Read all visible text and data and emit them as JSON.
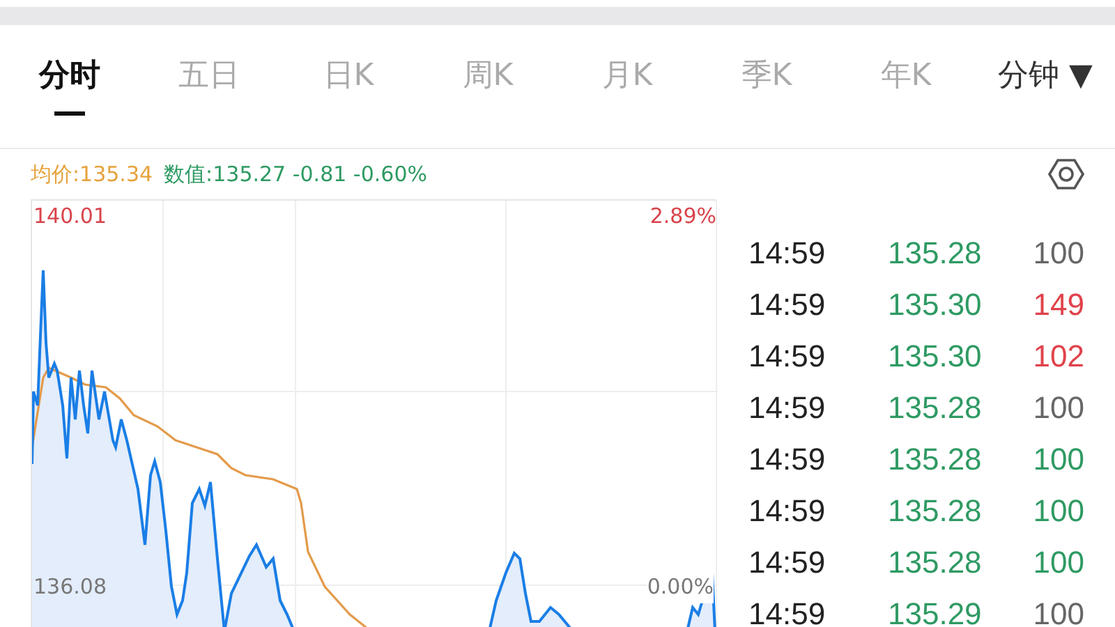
{
  "tabs": [
    {
      "label": "分时",
      "selected": true
    },
    {
      "label": "五日",
      "selected": false
    },
    {
      "label": "日K",
      "selected": false
    },
    {
      "label": "周K",
      "selected": false
    },
    {
      "label": "月K",
      "selected": false
    },
    {
      "label": "季K",
      "selected": false
    },
    {
      "label": "年K",
      "selected": false
    }
  ],
  "interval_menu": {
    "label": "分钟",
    "caret": "▼"
  },
  "summary": {
    "average": "均价:135.34",
    "value": "数值:135.27 -0.81 -0.60%"
  },
  "chart": {
    "price_high": "140.01",
    "change_high": "2.89%",
    "price_mid": "136.08",
    "change_mid": "0.00%"
  },
  "trades": [
    {
      "time": "14:59",
      "price": "135.28",
      "volume": "100",
      "color": "#666666"
    },
    {
      "time": "14:59",
      "price": "135.30",
      "volume": "149",
      "color": "#e0424b"
    },
    {
      "time": "14:59",
      "price": "135.30",
      "volume": "102",
      "color": "#e0424b"
    },
    {
      "time": "14:59",
      "price": "135.28",
      "volume": "100",
      "color": "#666666"
    },
    {
      "time": "14:59",
      "price": "135.28",
      "volume": "100",
      "color": "#2e9a63"
    },
    {
      "time": "14:59",
      "price": "135.28",
      "volume": "100",
      "color": "#2e9a63"
    },
    {
      "time": "14:59",
      "price": "135.28",
      "volume": "100",
      "color": "#2e9a63"
    },
    {
      "time": "14:59",
      "price": "135.29",
      "volume": "100",
      "color": "#666666"
    }
  ]
}
